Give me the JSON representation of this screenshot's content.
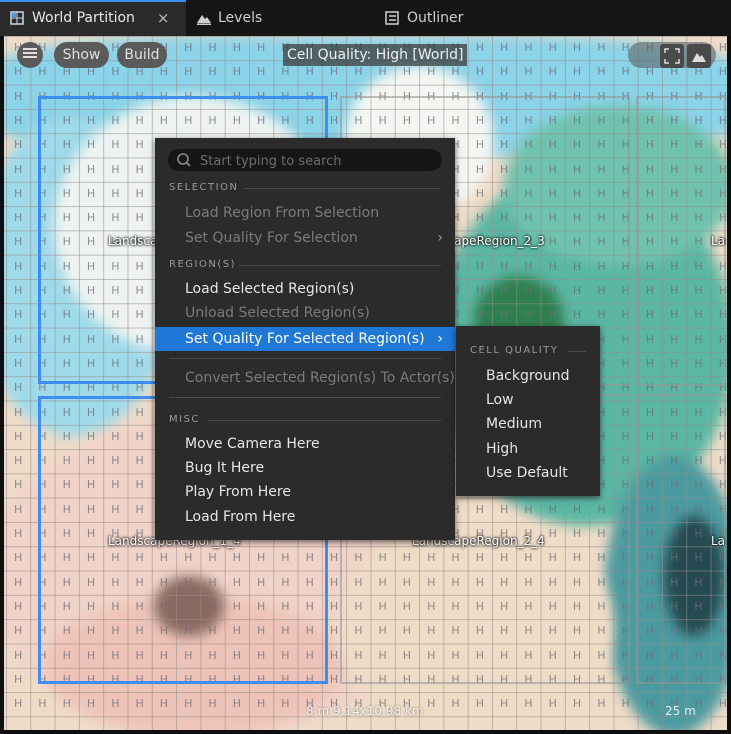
{
  "tabs": [
    {
      "label": "World Partition",
      "icon": "world-partition-icon",
      "close": "×"
    },
    {
      "label": "Levels",
      "icon": "levels-icon"
    },
    {
      "label": "Outliner",
      "icon": "outliner-icon"
    }
  ],
  "viewport": {
    "menu_button_icon": "hamburger-icon",
    "show_label": "Show",
    "build_label": "Build",
    "cell_quality_label": "Cell Quality: High [World]",
    "scale_text": "8 m 9.14x10.98 km",
    "scale_text_right": "25 m",
    "cell_letter": "H",
    "region_labels": [
      "LandscapeRegion_1_3",
      "LandscapeRegion_2_3",
      "La",
      "LandscapeRegion_1_4",
      "LandscapeRegion_2_4",
      "La"
    ]
  },
  "context_menu": {
    "search_placeholder": "Start typing to search",
    "sections": {
      "selection": "SELECTION",
      "regions": "REGION(S)",
      "misc": "MISC"
    },
    "items": {
      "load_region_from_selection": "Load Region From Selection",
      "set_quality_for_selection": "Set Quality For Selection",
      "load_selected_regions": "Load Selected Region(s)",
      "unload_selected_regions": "Unload Selected Region(s)",
      "set_quality_for_selected_regions": "Set Quality For Selected Region(s)",
      "convert_selected_regions": "Convert Selected Region(s) To Actor(s)",
      "move_camera_here": "Move Camera Here",
      "bug_it_here": "Bug It Here",
      "play_from_here": "Play From Here",
      "load_from_here": "Load From Here"
    },
    "arrow": "›"
  },
  "submenu": {
    "section": "CELL QUALITY",
    "items": [
      "Background",
      "Low",
      "Medium",
      "High",
      "Use Default"
    ]
  },
  "colors": {
    "highlight": "#1f77d6",
    "region_outline": "#3d8ef0"
  }
}
